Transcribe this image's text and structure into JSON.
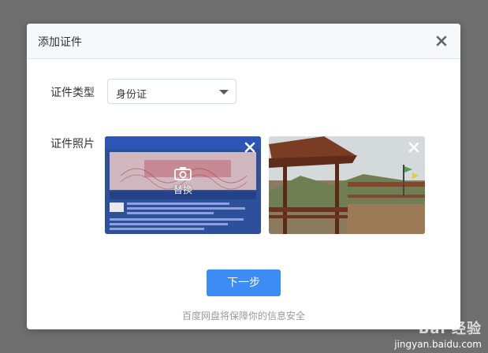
{
  "dialog": {
    "title": "添加证件",
    "close_icon": "close-icon"
  },
  "form": {
    "type_label": "证件类型",
    "type_selected": "身份证",
    "photo_label": "证件照片"
  },
  "photos": [
    {
      "kind": "id-card-image",
      "replace_label": "替换",
      "remove_icon": "close-icon",
      "camera_icon": "camera-icon"
    },
    {
      "kind": "pavilion-image",
      "remove_icon": "close-icon"
    }
  ],
  "actions": {
    "next_label": "下一步"
  },
  "footer": {
    "note": "百度网盘将保障你的信息安全"
  },
  "watermark": {
    "logo": "Bai 经验",
    "url": "jingyan.baidu.com"
  },
  "colors": {
    "overlay": "#6f6f6f",
    "header_bg": "#f6f8fc",
    "primary": "#3b8cf5",
    "text": "#333333",
    "muted": "#999999"
  }
}
